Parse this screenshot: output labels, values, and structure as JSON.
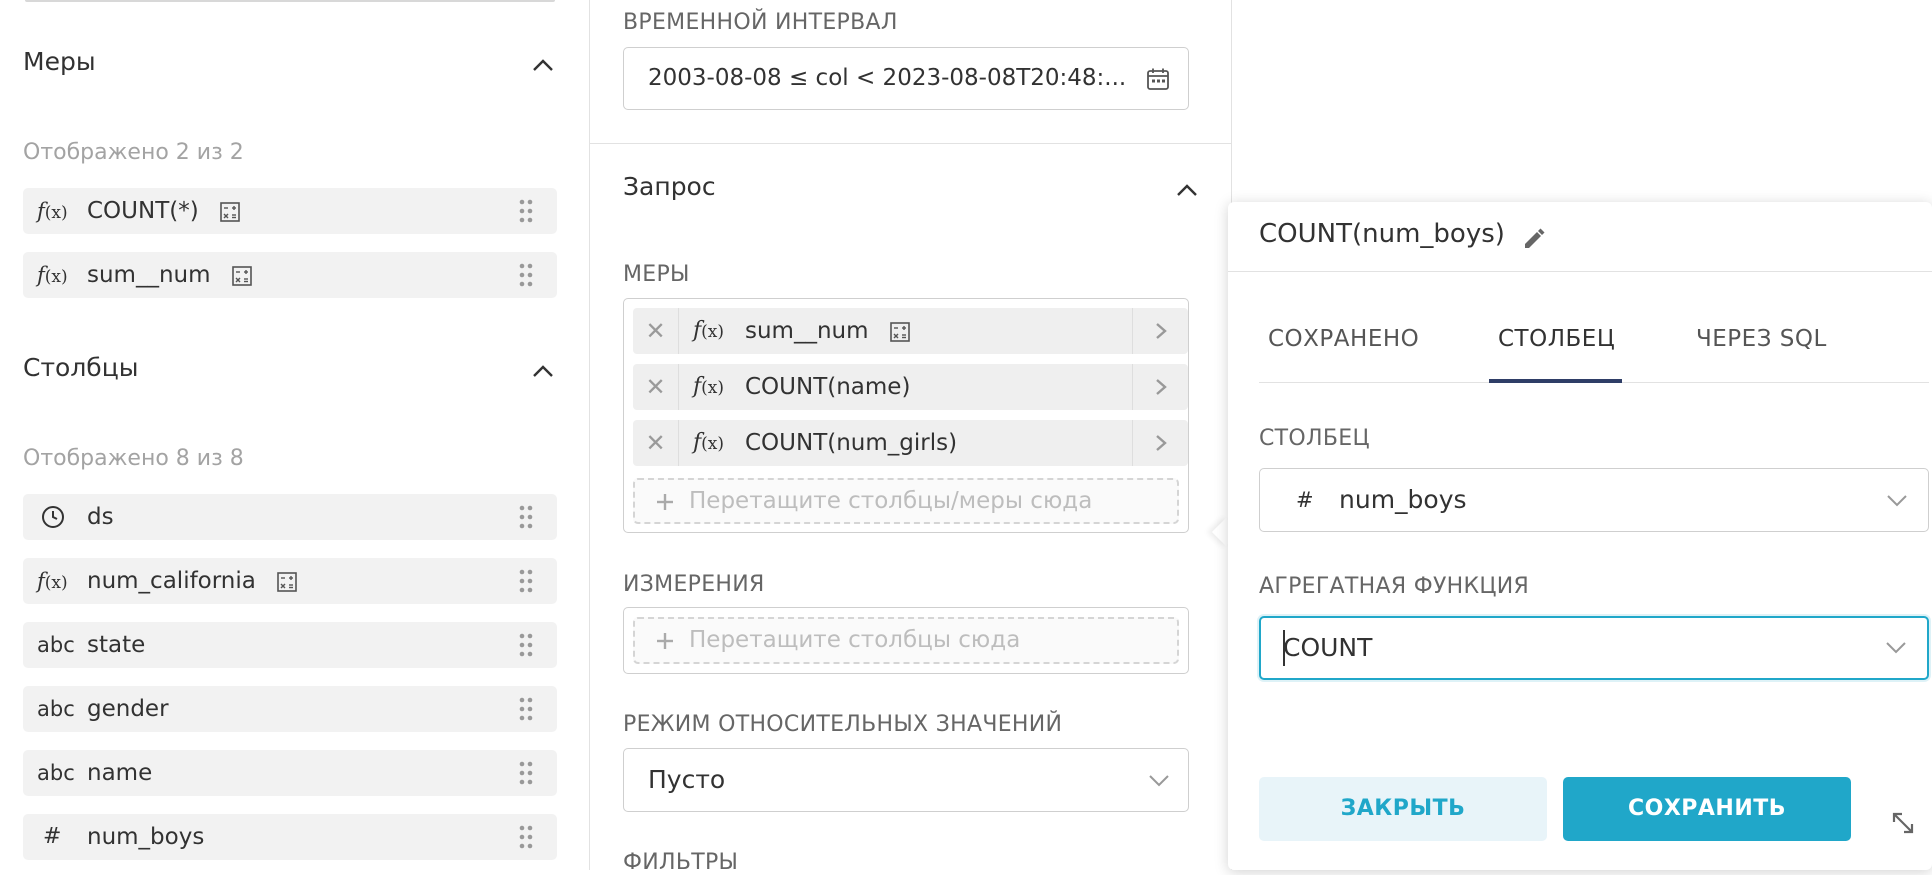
{
  "left": {
    "metrics_section": {
      "title": "Меры",
      "shown": "Отображено 2 из 2",
      "items": [
        {
          "type": "f(x)",
          "label": "COUNT(*)"
        },
        {
          "type": "f(x)",
          "label": "sum__num"
        }
      ]
    },
    "columns_section": {
      "title": "Столбцы",
      "shown": "Отображено 8 из 8",
      "items": [
        {
          "type": "clock",
          "label": "ds"
        },
        {
          "type": "f(x)",
          "label": "num_california"
        },
        {
          "type": "abc",
          "label": "state"
        },
        {
          "type": "abc",
          "label": "gender"
        },
        {
          "type": "abc",
          "label": "name"
        },
        {
          "type": "#",
          "label": "num_boys"
        }
      ]
    }
  },
  "middle": {
    "time_range_label": "ВРЕМЕННОЙ ИНТЕРВАЛ",
    "time_range_value": "2003-08-08 ≤ col < 2023-08-08T20:48:...",
    "query_title": "Запрос",
    "metrics_label": "МЕРЫ",
    "metrics": [
      {
        "label": "sum__num",
        "has_calc_icon": true
      },
      {
        "label": "COUNT(name)",
        "has_calc_icon": false
      },
      {
        "label": "COUNT(num_girls)",
        "has_calc_icon": false
      }
    ],
    "metrics_dropzone": "Перетащите столбцы/меры сюда",
    "dimensions_label": "ИЗМЕРЕНИЯ",
    "dimensions_dropzone": "Перетащите столбцы сюда",
    "relative_mode_label": "РЕЖИМ ОТНОСИТЕЛЬНЫХ ЗНАЧЕНИЙ",
    "relative_mode_value": "Пусто",
    "filters_label": "ФИЛЬТРЫ"
  },
  "popover": {
    "title": "COUNT(num_boys)",
    "tabs": [
      {
        "label": "СОХРАНЕНО",
        "active": false
      },
      {
        "label": "СТОЛБЕЦ",
        "active": true
      },
      {
        "label": "ЧЕРЕЗ SQL",
        "active": false
      }
    ],
    "column_label": "СТОЛБЕЦ",
    "column_value": "num_boys",
    "agg_label": "АГРЕГАТНАЯ ФУНКЦИЯ",
    "agg_value": "COUNT",
    "close_label": "ЗАКРЫТЬ",
    "save_label": "СОХРАНИТЬ"
  },
  "colors": {
    "primary": "#20a7c9",
    "primary_light": "#e8f4f9",
    "tab_underline": "#2f3e67",
    "focus_border": "#20a7c9"
  },
  "icons": [
    "chevron-up-icon",
    "calculator-icon",
    "drag-handle-icon",
    "clock-icon",
    "hash-icon",
    "calendar-icon",
    "close-icon",
    "chevron-right-icon",
    "plus-icon",
    "chevron-down-icon",
    "pencil-icon",
    "resize-icon"
  ]
}
